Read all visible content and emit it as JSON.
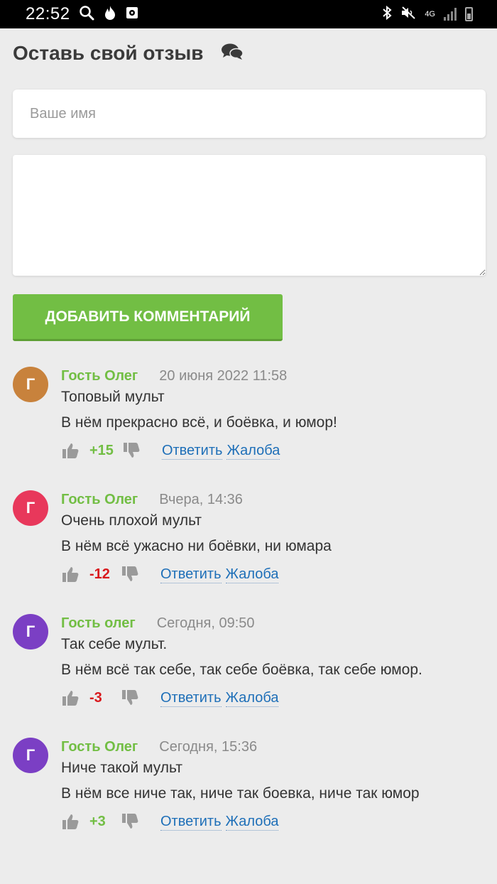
{
  "status_bar": {
    "time": "22:52",
    "network": "4G"
  },
  "form": {
    "title": "Оставь свой отзыв",
    "name_placeholder": "Ваше имя",
    "submit_label": "ДОБАВИТЬ КОММЕНТАРИЙ"
  },
  "colors": {
    "accent": "#72be44",
    "link": "#1e6fb8",
    "negative": "#d9191d"
  },
  "comments": [
    {
      "initial": "Г",
      "avatar_color": "#c8823c",
      "author": "Гость Олег",
      "date": "20 июня 2022 11:58",
      "line1": "Топовый мульт",
      "line2": "В нём прекрасно всё, и боёвка, и юмор!",
      "score": "+15",
      "reply_label": "Ответить",
      "report_label": "Жалоба"
    },
    {
      "initial": "Г",
      "avatar_color": "#e8385b",
      "author": "Гость Олег",
      "date": "Вчера, 14:36",
      "line1": "Очень плохой мульт",
      "line2": "В нём всё ужасно ни боёвки, ни юмара",
      "score": "-12",
      "reply_label": "Ответить",
      "report_label": "Жалоба"
    },
    {
      "initial": "Г",
      "avatar_color": "#7b3fc4",
      "author": "Гость олег",
      "date": "Сегодня, 09:50",
      "line1": "Так себе мульт.",
      "line2": "В нём всё так себе, так себе боёвка, так себе юмор.",
      "score": "-3",
      "reply_label": "Ответить",
      "report_label": "Жалоба"
    },
    {
      "initial": "Г",
      "avatar_color": "#7b3fc4",
      "author": "Гость Олег",
      "date": "Сегодня, 15:36",
      "line1": "Ниче такой мульт",
      "line2": "В нём все ниче так, ниче так боевка, ниче так юмор",
      "score": "+3",
      "reply_label": "Ответить",
      "report_label": "Жалоба"
    }
  ]
}
